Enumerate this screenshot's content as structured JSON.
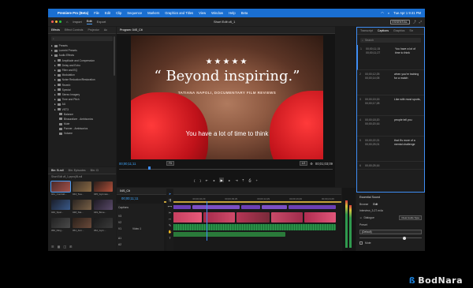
{
  "menubar": {
    "app": "Premiere Pro (Beta)",
    "items": [
      "File",
      "Edit",
      "Clip",
      "Sequence",
      "Markers",
      "Graphics and Titles",
      "View",
      "Window",
      "Help",
      "Beta"
    ],
    "clock": "Tue Apr 1  9:41 PM"
  },
  "workspace": {
    "tabs": [
      "Import",
      "Edit",
      "Export"
    ],
    "active_tab": "Edit",
    "project_name": "Short Edit v8_1",
    "layout_label": "ESSENTIAL"
  },
  "effects_panel": {
    "tabs": [
      "Effects",
      "Effect Controls",
      "Projector",
      "Ac"
    ],
    "items": [
      {
        "label": "Presets",
        "indent": 1
      },
      {
        "label": "Lumetri Presets",
        "indent": 1
      },
      {
        "label": "Audio Effects",
        "indent": 1
      },
      {
        "label": "Amplitude and Compression",
        "indent": 2
      },
      {
        "label": "Delay and Echo",
        "indent": 2
      },
      {
        "label": "Filter and EQ",
        "indent": 2
      },
      {
        "label": "Modulation",
        "indent": 2
      },
      {
        "label": "Noise Reduction/Restoration",
        "indent": 2
      },
      {
        "label": "Reverb",
        "indent": 2
      },
      {
        "label": "Special",
        "indent": 2
      },
      {
        "label": "Stereo Imagery",
        "indent": 2
      },
      {
        "label": "Time and Pitch",
        "indent": 2
      },
      {
        "label": "AU",
        "indent": 2
      },
      {
        "label": "VST3",
        "indent": 2
      },
      {
        "label": "Balance",
        "indent": 3
      },
      {
        "label": "Binauralizer - Ambisonics",
        "indent": 3
      },
      {
        "label": "Mute",
        "indent": 3
      },
      {
        "label": "Panner - Ambisonics",
        "indent": 3
      },
      {
        "label": "Volume",
        "indent": 3
      }
    ]
  },
  "bins_panel": {
    "tabs": [
      "Bin: B-roll",
      "Bin: Episodes",
      "Bin: Cl"
    ],
    "path": "Short Edit v8_1.prproj\\B-roll",
    "clips": [
      {
        "name": "041_Contrab...",
        "dur": "4:28",
        "colors": [
          "#4a2a2a",
          "#a5524a"
        ]
      },
      {
        "name": "044_Tea...",
        "dur": "",
        "colors": [
          "#3a3028",
          "#8a6a44"
        ]
      },
      {
        "name": "045_Gymnas...",
        "dur": "",
        "colors": [
          "#2a1e1a",
          "#b2503a"
        ]
      },
      {
        "name": "046_Spar...",
        "dur": "",
        "colors": [
          "#1a1e2a",
          "#3a5a8a"
        ]
      },
      {
        "name": "048_Sta...",
        "dur": "",
        "colors": [
          "#2a2420",
          "#7a6248"
        ]
      },
      {
        "name": "049_Boxe...",
        "dur": "",
        "colors": [
          "#1e1a22",
          "#5a4a6a"
        ]
      },
      {
        "name": "050_Ring...",
        "dur": "",
        "colors": [
          "#222",
          "#4a4a4a"
        ]
      },
      {
        "name": "051_Ann...",
        "dur": "",
        "colors": [
          "#2a201a",
          "#6a4a3a"
        ]
      },
      {
        "name": "052_Gym...",
        "dur": "",
        "colors": [
          "#1a1a1a",
          "#3a3a3a"
        ]
      }
    ]
  },
  "program": {
    "tab": "Program: 04S_Cit",
    "stars": "★★★★★",
    "quote": "“ Beyond inspiring.”",
    "credit": "TATIANA NAPOLI, DOCUMENTARY FILM REVIEWS",
    "subtitle": "You have a lot of time to think",
    "timecode_left": "00;00;11;11",
    "timecode_right": "00;01;03;09",
    "fit": "Fit",
    "quality": "1/2"
  },
  "text_panel": {
    "tabs": [
      "Transcript",
      "Captions",
      "Graphics",
      "Sn"
    ],
    "active_tab": "Captions",
    "search_placeholder": "Search",
    "captions": [
      {
        "n": "1",
        "in": "00;00;11;15",
        "out": "00;00;11;27",
        "text": "You have a lot of time to think"
      },
      {
        "n": "2",
        "in": "00;00;12;25",
        "out": "00;00;14;05",
        "text": "when you're training for a match"
      },
      {
        "n": "3",
        "in": "00;00;15;15",
        "out": "00;00;17;28",
        "text": "Like with most sports,"
      },
      {
        "n": "4",
        "in": "00;00;18;20",
        "out": "00;00;20;16",
        "text": "people tell you"
      },
      {
        "n": "5",
        "in": "00;00;22;21",
        "out": "00;00;25;01",
        "text": "that it's more of a mental challenge"
      },
      {
        "n": "6",
        "in": "00;00;25;16",
        "out": "",
        "text": ""
      }
    ]
  },
  "timeline": {
    "tab": "04S_Cit",
    "timecode": "00;00;11;11",
    "ruler": [
      "00;00",
      "00;00;04;29",
      "00;00;09;29",
      "00;00;14;29",
      "00;00;19;29",
      "00;00;24;29",
      "00;00;29;29",
      "00;00;34;28"
    ],
    "captions_label": "Captions",
    "video_label": "Video 1",
    "tracks": [
      "V3",
      "V2",
      "V1",
      "A1",
      "A2",
      "A3"
    ]
  },
  "essential_sound": {
    "title": "Essential Sound",
    "tabs": [
      "Browse",
      "Edit"
    ],
    "active_tab": "Edit",
    "clip_name": "Interview_3-27.m4a",
    "type": "Dialogue",
    "clear_label": "Clear Audio Type",
    "preset_label": "Preset",
    "preset_value": "(Default)",
    "mute_label": "Mute"
  },
  "watermark": "BodNara",
  "colors": {
    "accent": "#3f8ef5",
    "menubar": "#1a6fd1",
    "timecode": "#3fa9ff"
  }
}
